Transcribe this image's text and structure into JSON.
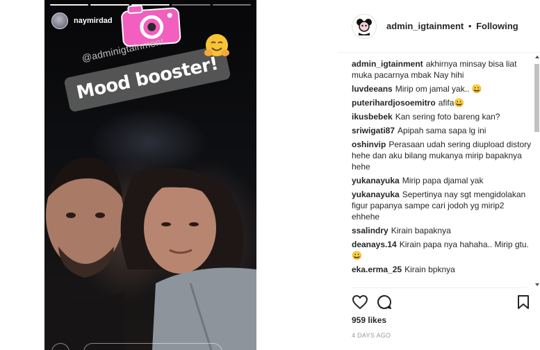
{
  "story": {
    "username": "naymirdad",
    "mention": "@adminigtainment",
    "caption": "Mood booster!"
  },
  "post": {
    "header": {
      "username": "admin_igtainment",
      "separator": "•",
      "follow_state": "Following"
    },
    "comments": [
      {
        "user": "admin_igtainment",
        "text": "akhirnya minsay bisa liat muka pacarnya mbak Nay hihi"
      },
      {
        "user": "luvdeeans",
        "text": "Mirip om jamal yak.. 😀"
      },
      {
        "user": "puterihardjosoemitro",
        "text": "afifa😀"
      },
      {
        "user": "ikusbebek",
        "text": "Kan sering foto bareng kan?"
      },
      {
        "user": "sriwigati87",
        "text": "Apipah sama sapa lg ini"
      },
      {
        "user": "oshinvip",
        "text": "Perasaan udah sering diupload distory hehe dan aku bilang mukanya mirip bapaknya hehe"
      },
      {
        "user": "yukanayuka",
        "text": "Mirip papa djamal yak"
      },
      {
        "user": "yukanayuka",
        "text": "Sepertinya nay sgt mengidolakan figur papanya sampe cari jodoh yg mirip2 ehhehe"
      },
      {
        "user": "ssalindry",
        "text": "Kirain bapaknya"
      },
      {
        "user": "deanays.14",
        "text": "Kirain papa nya hahaha.. Mirip gtu. 😀"
      },
      {
        "user": "eka.erma_25",
        "text": "Kirain bpknya"
      }
    ],
    "likes": "959 likes",
    "time": "4 DAYS AGO",
    "icons": {
      "like": "heart-icon",
      "comment": "comment-icon",
      "save": "bookmark-icon"
    }
  }
}
